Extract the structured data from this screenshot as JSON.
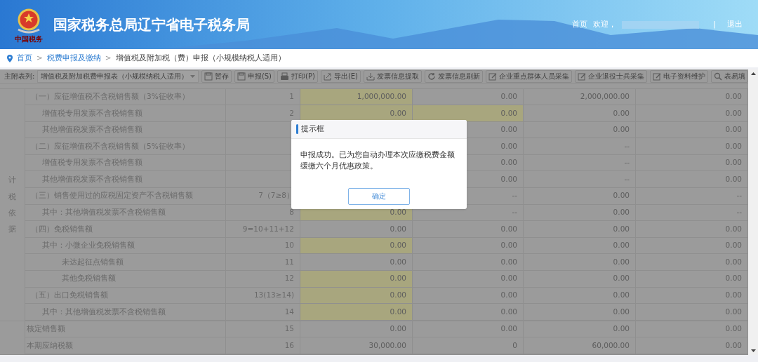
{
  "header": {
    "title": "国家税务总局辽宁省电子税务局",
    "emblem_caption": "中国税务",
    "nav": [
      {
        "label": "首页"
      },
      {
        "label": "欢迎，"
      }
    ],
    "divider": "|",
    "logout": "退出"
  },
  "breadcrumb": {
    "separator": ">",
    "items": [
      {
        "label": "首页",
        "link": true
      },
      {
        "label": "税费申报及缴纳",
        "link": true
      },
      {
        "label": "增值税及附加税（费）申报（小规模纳税人适用）",
        "link": false
      }
    ]
  },
  "toolbar": {
    "label": "主附表列:",
    "select": "增值税及附加税费申报表（小规模纳税人适用）",
    "buttons": [
      {
        "label": "暂存"
      },
      {
        "label": "申报(S)"
      },
      {
        "label": "打印(P)"
      },
      {
        "label": "导出(E)"
      },
      {
        "label": "发票信息提取"
      },
      {
        "label": "发票信息刷新"
      },
      {
        "label": "企业重点群体人员采集"
      },
      {
        "label": "企业退役士兵采集"
      },
      {
        "label": "电子资料维护"
      },
      {
        "label": "表易填"
      }
    ]
  },
  "table": {
    "sections": [
      {
        "side_label": "计税依据",
        "rows": [
          {
            "kind": "section",
            "label": "（一）应征增值税不含税销售额（3%征收率）",
            "line": "1",
            "values": [
              "1,000,000.00",
              "0.00",
              "2,000,000.00",
              "0.00"
            ],
            "editable": [
              true,
              false,
              false,
              false
            ],
            "children": [
              {
                "label": "增值税专用发票不含税销售额",
                "line": "2",
                "values": [
                  "0.00",
                  "0.00",
                  "0.00",
                  "0.00"
                ],
                "editable": [
                  true,
                  true,
                  false,
                  false
                ]
              },
              {
                "label": "其他增值税发票不含税销售额",
                "values": [
                  "0.00",
                  "0.00",
                  "0.00"
                ],
                "editable": [
                  false,
                  false,
                  false
                ]
              }
            ]
          },
          {
            "kind": "section",
            "label": "（二）应征增值税不含税销售额（5%征收率）",
            "values": [
              "0.00",
              "--",
              "0.00"
            ],
            "editable": [
              false,
              false,
              false
            ],
            "children": [
              {
                "label": "增值税专用发票不含税销售额",
                "values": [
                  "0.00",
                  "--",
                  "0.00"
                ],
                "editable": [
                  false,
                  false,
                  false
                ]
              },
              {
                "label": "其他增值税发票不含税销售额",
                "values": [
                  "0.00",
                  "--",
                  "0.00"
                ],
                "editable": [
                  false,
                  false,
                  false
                ]
              }
            ]
          },
          {
            "kind": "section",
            "label": "（三）销售使用过的应税固定资产不含税销售额",
            "line": "7（7≥8）",
            "values": [
              "--",
              "0.00",
              "--"
            ],
            "editable": [
              false,
              false,
              false
            ],
            "children": [
              {
                "label": "其中：其他增值税发票不含税销售额",
                "line": "8",
                "values": [
                  "0.00",
                  "--",
                  "0.00",
                  "--"
                ],
                "editable": [
                  true,
                  false,
                  false,
                  false
                ]
              }
            ]
          },
          {
            "kind": "section",
            "label": "（四）免税销售额",
            "line": "9=10+11+12",
            "values": [
              "0.00",
              "0.00",
              "0.00",
              "0.00"
            ],
            "editable": [
              false,
              false,
              false,
              false
            ],
            "children": [
              {
                "label": "其中：小微企业免税销售额",
                "line": "10",
                "values": [
                  "0.00",
                  "0.00",
                  "0.00",
                  "0.00"
                ],
                "editable": [
                  true,
                  false,
                  false,
                  false
                ],
                "children": [
                  {
                    "label": "未达起征点销售额",
                    "line": "11",
                    "values": [
                      "0.00",
                      "0.00",
                      "0.00",
                      "0.00"
                    ],
                    "editable": [
                      false,
                      false,
                      false,
                      false
                    ]
                  },
                  {
                    "label": "其他免税销售额",
                    "line": "12",
                    "values": [
                      "0.00",
                      "0.00",
                      "0.00",
                      "0.00"
                    ],
                    "editable": [
                      true,
                      false,
                      false,
                      false
                    ]
                  }
                ]
              }
            ]
          },
          {
            "kind": "section",
            "label": "（五）出口免税销售额",
            "line": "13(13≥14)",
            "values": [
              "0.00",
              "0.00",
              "0.00",
              "0.00"
            ],
            "editable": [
              true,
              false,
              false,
              false
            ],
            "children": [
              {
                "label": "其中：其他增值税发票不含税销售额",
                "line": "14",
                "values": [
                  "0.00",
                  "0.00",
                  "0.00",
                  "0.00"
                ],
                "editable": [
                  true,
                  false,
                  false,
                  false
                ]
              }
            ]
          }
        ]
      },
      {
        "rows": [
          {
            "kind": "total",
            "label": "核定销售额",
            "line": "15",
            "values": [
              "0.00",
              "0.00",
              "0.00",
              "0.00"
            ],
            "editable": [
              false,
              false,
              false,
              false
            ]
          },
          {
            "kind": "total",
            "label": "本期应纳税额",
            "line": "16",
            "values": [
              "30,000.00",
              "0",
              "60,000.00",
              "0.00"
            ],
            "editable": [
              false,
              false,
              false,
              false
            ]
          }
        ]
      }
    ]
  },
  "dialog": {
    "title": "提示框",
    "message": "申报成功。已为您自动办理本次应缴税费金额缓缴六个月优惠政策。",
    "button": "确定"
  }
}
